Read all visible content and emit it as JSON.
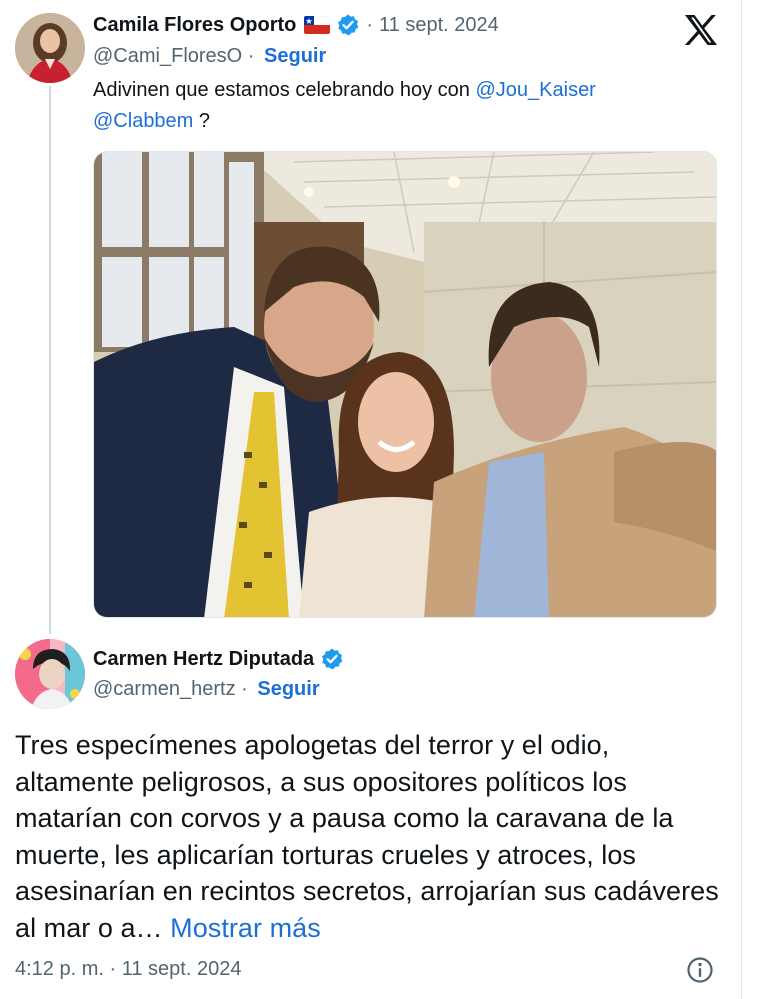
{
  "tweet1": {
    "author_name": "Camila Flores Oporto",
    "flag_emoji": "chile-flag",
    "verified": true,
    "separator": "·",
    "date": "11 sept. 2024",
    "handle": "@Cami_FloresO",
    "handle_sep": "·",
    "follow_label": "Seguir",
    "text_before": "Adivinen que estamos celebrando hoy con ",
    "mention1": "@Jou_Kaiser",
    "mention2": "@Clabbem",
    "text_after": " ?"
  },
  "tweet2": {
    "author_name": "Carmen Hertz Diputada",
    "verified": true,
    "handle": "@carmen_hertz",
    "handle_sep": "·",
    "follow_label": "Seguir",
    "text": "Tres especímenes apologetas del terror y el odio, altamente peligrosos, a sus opositores políticos los matarían con corvos y a pausa como la caravana de la muerte, les aplicarían torturas crueles y atroces, los asesinarían en recintos secretos, arrojarían sus cadáveres al mar o a…",
    "show_more": "Mostrar más",
    "timestamp": "4:12 p. m. · 11 sept. 2024"
  },
  "icons": {
    "platform_logo": "x-logo-icon",
    "info": "info-icon",
    "verified": "verified-badge-icon"
  },
  "colors": {
    "link": "#1d6fd6",
    "secondary_text": "#536471",
    "verified_blue": "#1d9bf0",
    "thread_line": "#cfd9de"
  }
}
